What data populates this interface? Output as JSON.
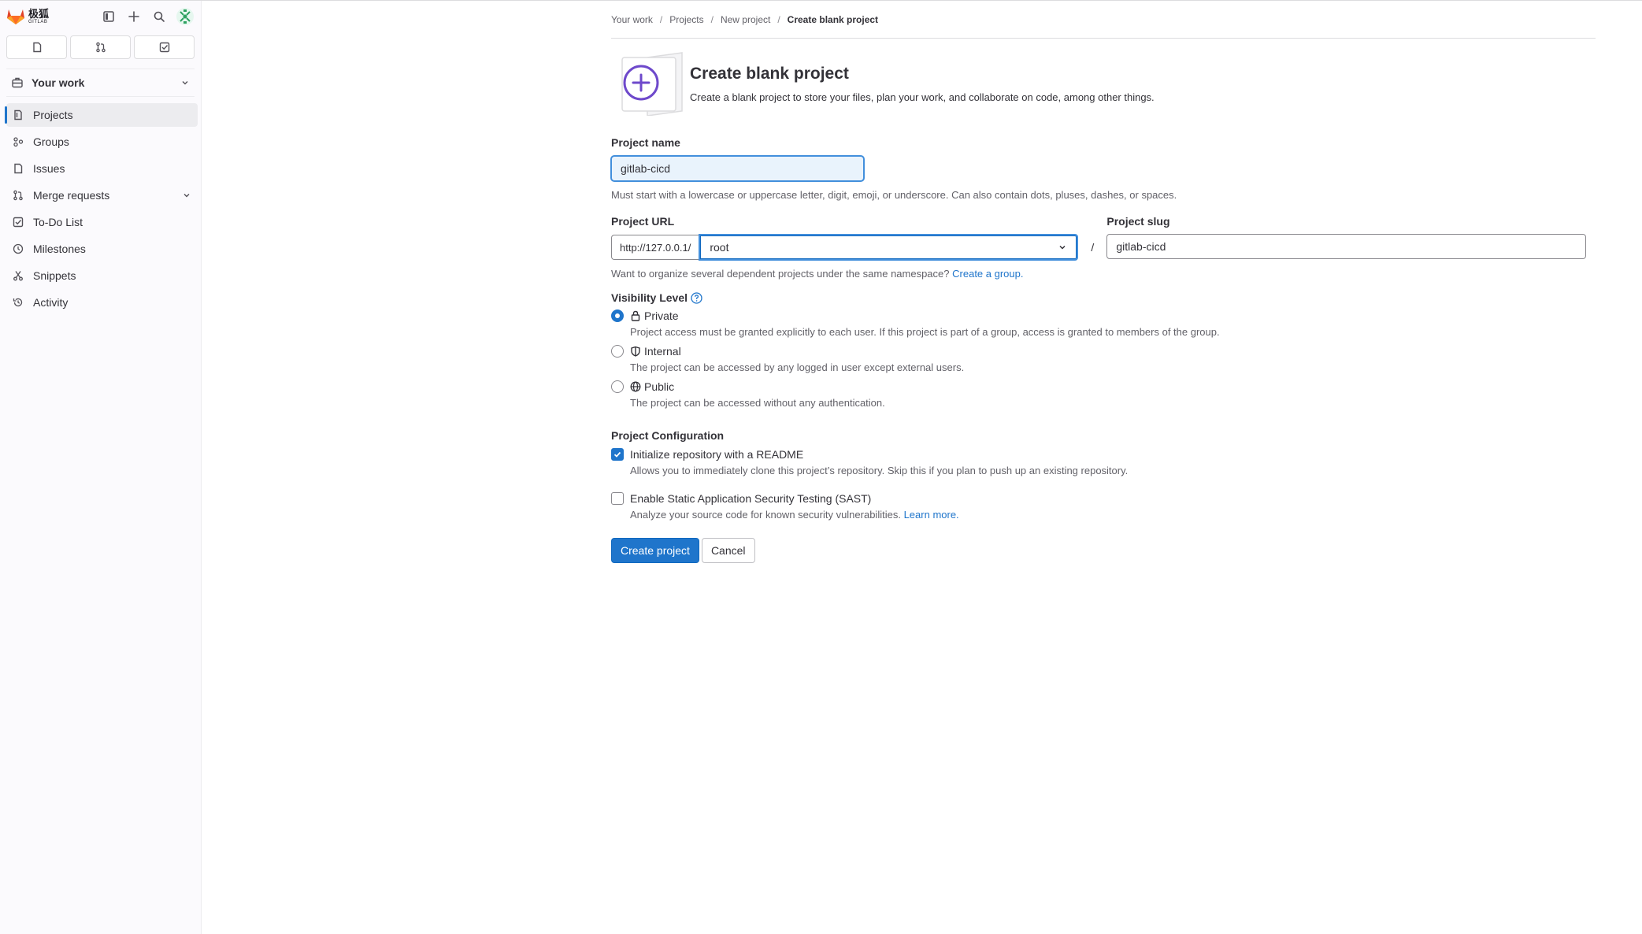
{
  "sidebar": {
    "brand_cn": "极狐",
    "brand_en": "GITLAB",
    "context_title": "Your work",
    "items": [
      {
        "label": "Projects"
      },
      {
        "label": "Groups"
      },
      {
        "label": "Issues"
      },
      {
        "label": "Merge requests"
      },
      {
        "label": "To-Do List"
      },
      {
        "label": "Milestones"
      },
      {
        "label": "Snippets"
      },
      {
        "label": "Activity"
      }
    ]
  },
  "breadcrumb": {
    "items": [
      "Your work",
      "Projects",
      "New project"
    ],
    "current": "Create blank project"
  },
  "header": {
    "title": "Create blank project",
    "description": "Create a blank project to store your files, plan your work, and collaborate on code, among other things."
  },
  "form": {
    "project_name": {
      "label": "Project name",
      "value": "gitlab-cicd",
      "help": "Must start with a lowercase or uppercase letter, digit, emoji, or underscore. Can also contain dots, pluses, dashes, or spaces."
    },
    "project_url": {
      "label": "Project URL",
      "prefix": "http://127.0.0.1/",
      "namespace": "root",
      "separator": "/"
    },
    "project_slug": {
      "label": "Project slug",
      "value": "gitlab-cicd"
    },
    "namespace_help": "Want to organize several dependent projects under the same namespace?",
    "namespace_link": "Create a group.",
    "visibility": {
      "label": "Visibility Level",
      "options": [
        {
          "label": "Private",
          "help": "Project access must be granted explicitly to each user. If this project is part of a group, access is granted to members of the group.",
          "checked": true
        },
        {
          "label": "Internal",
          "help": "The project can be accessed by any logged in user except external users.",
          "checked": false
        },
        {
          "label": "Public",
          "help": "The project can be accessed without any authentication.",
          "checked": false
        }
      ]
    },
    "configuration": {
      "label": "Project Configuration",
      "readme": {
        "label": "Initialize repository with a README",
        "help": "Allows you to immediately clone this project’s repository. Skip this if you plan to push up an existing repository.",
        "checked": true
      },
      "sast": {
        "label": "Enable Static Application Security Testing (SAST)",
        "help": "Analyze your source code for known security vulnerabilities.",
        "link": "Learn more.",
        "checked": false
      }
    },
    "buttons": {
      "create": "Create project",
      "cancel": "Cancel"
    }
  },
  "colors": {
    "accent": "#1f75cb",
    "brand": "#e24329",
    "illustration": "#6e49cb"
  }
}
